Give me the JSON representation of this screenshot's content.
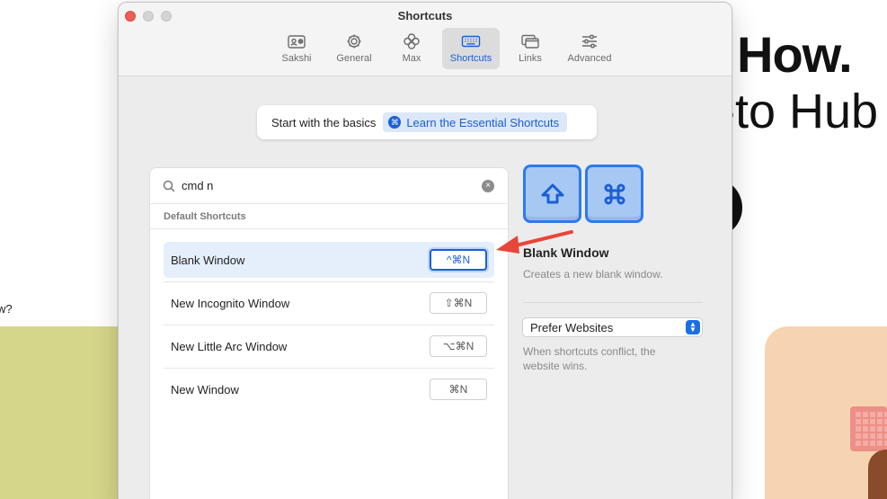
{
  "background": {
    "heading": "How.",
    "subheading": "-to Hub",
    "question_fragment": "w?"
  },
  "window": {
    "title": "Shortcuts",
    "toolbar": [
      {
        "label": "Sakshi",
        "icon": "profile-card-icon"
      },
      {
        "label": "General",
        "icon": "gear-icon"
      },
      {
        "label": "Max",
        "icon": "max-flower-icon"
      },
      {
        "label": "Shortcuts",
        "icon": "keyboard-icon",
        "active": true
      },
      {
        "label": "Links",
        "icon": "windows-icon"
      },
      {
        "label": "Advanced",
        "icon": "sliders-icon"
      }
    ],
    "basics": {
      "text": "Start with the basics",
      "button": "Learn the Essential Shortcuts"
    },
    "search": {
      "value": "cmd n"
    },
    "section_label": "Default Shortcuts",
    "shortcuts": [
      {
        "label": "Blank Window",
        "keys": "^⌘N",
        "selected": true
      },
      {
        "label": "New Incognito Window",
        "keys": "⇧⌘N"
      },
      {
        "label": "New Little Arc Window",
        "keys": "⌥⌘N"
      },
      {
        "label": "New Window",
        "keys": "⌘N"
      }
    ],
    "detail": {
      "title": "Blank Window",
      "description": "Creates a new blank window.",
      "conflict_select": "Prefer Websites",
      "hint": "When shortcuts conflict, the website wins."
    },
    "colors": {
      "accent": "#1a5fd6",
      "arrow": "#e8463a"
    }
  }
}
